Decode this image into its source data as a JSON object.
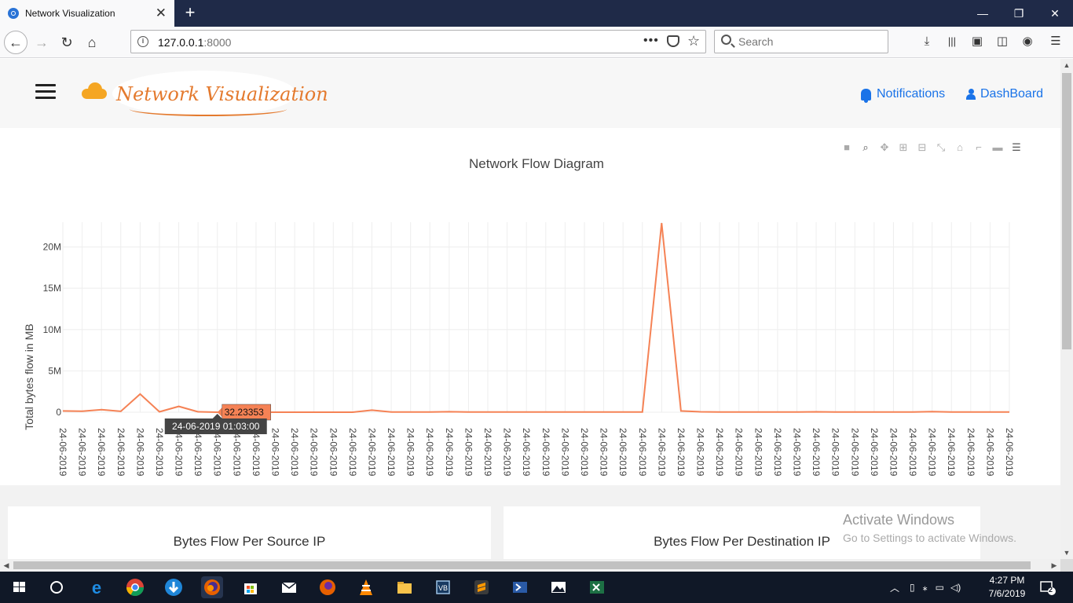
{
  "browser": {
    "tab_title": "Network Visualization",
    "tab_close": "✕",
    "new_tab": "+",
    "url_host": "127.0.0.1",
    "url_port": ":8000",
    "url_more": "•••",
    "search_placeholder": "Search"
  },
  "window_controls": {
    "minimize": "—",
    "restore": "❐",
    "close": "✕"
  },
  "header": {
    "logo_text": "Network Visualization",
    "nav": {
      "notifications": "Notifications",
      "dashboard": "DashBoard"
    }
  },
  "chart_data": {
    "type": "line",
    "title": "Network Flow Diagram",
    "xlabel": "",
    "ylabel": "Total bytes flow in MB",
    "y_ticks": [
      "0",
      "5M",
      "10M",
      "15M",
      "20M"
    ],
    "ylim": [
      0,
      23000000
    ],
    "x_tick_label": "24-06-2019",
    "x_tick_count": 50,
    "grid": true,
    "legend": "none",
    "line_color": "#f58255",
    "series": [
      {
        "values": [
          150000,
          120000,
          300000,
          100000,
          2200000,
          50000,
          700000,
          50000,
          32.23353,
          32,
          32,
          32,
          32,
          32,
          32,
          32,
          250000,
          30000,
          20000,
          20000,
          60000,
          30000,
          20000,
          20000,
          20000,
          20000,
          20000,
          20000,
          20000,
          20000,
          20000,
          22900000,
          150000,
          50000,
          20000,
          20000,
          20000,
          20000,
          20000,
          50000,
          20000,
          20000,
          20000,
          20000,
          20000,
          80000,
          20000,
          20000,
          20000,
          20000
        ]
      }
    ],
    "hover": {
      "value_label": "32.23353",
      "x_label": "24-06-2019 01:03:00",
      "index": 8
    }
  },
  "cards": {
    "source": "Bytes Flow Per Source IP",
    "destination": "Bytes Flow Per Destination IP"
  },
  "watermark": {
    "line1": "Activate Windows",
    "line2": "Go to Settings to activate Windows."
  },
  "taskbar": {
    "time": "4:27 PM",
    "date": "7/6/2019",
    "notification_count": "2"
  }
}
